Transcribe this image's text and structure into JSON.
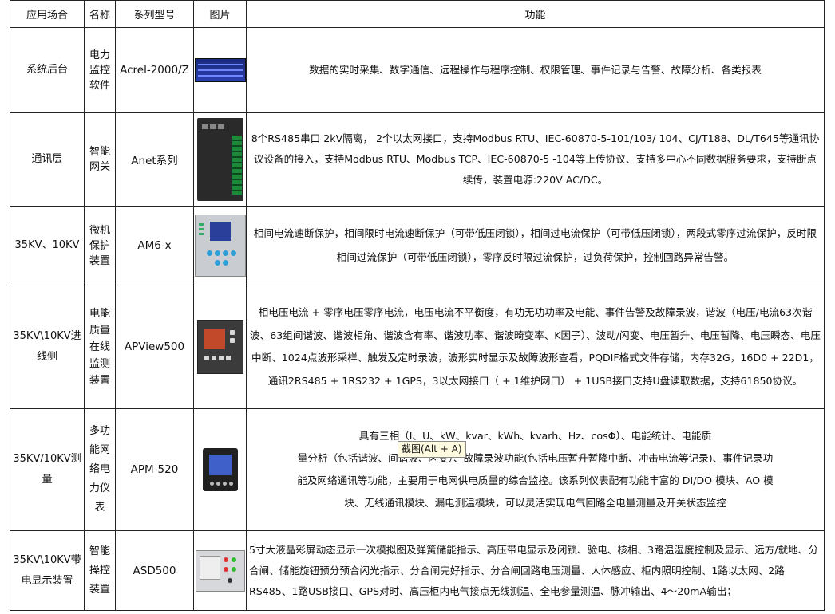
{
  "table": {
    "headers": [
      "应用场合",
      "名称",
      "系列型号",
      "图片",
      "功能"
    ],
    "rows": [
      {
        "scene": [
          "系统后台"
        ],
        "name": [
          "电力",
          "监控",
          "软件"
        ],
        "model": "Acrel-2000/Z",
        "image": "software-screenshot",
        "func": "数据的实时采集、数字通信、远程操作与程序控制、权限管理、事件记录与告警、故障分析、各类报表"
      },
      {
        "scene": [
          "通讯层"
        ],
        "name": [
          "智能",
          "网关"
        ],
        "model": "Anet系列",
        "image": "gateway-device",
        "func": "8个RS485串口 2kV隔离， 2个以太网接口，支持Modbus RTU、IEC-60870-5-101/103/ 104、CJ/T188、DL/T645等通讯协议设备的接入，支持Modbus RTU、Modbus TCP、IEC-60870-5 -104等上传协议、支持多中心不同数据服务要求，支持断点续传，装置电源:220V AC/DC。"
      },
      {
        "scene": [
          "35KV、10KV"
        ],
        "name": [
          "微机",
          "保护",
          "装置"
        ],
        "model": "AM6-x",
        "image": "protection-relay",
        "func": "相间电流速断保护，相间限时电流速断保护（可带低压闭锁），相间过电流保护（可带低压闭锁），两段式零序过流保护，反时限相间过流保护（可带低压闭锁），零序反时限过流保护，过负荷保护，控制回路异常告警。"
      },
      {
        "scene": [
          "35KV\\10KV进",
          "线侧"
        ],
        "name": [
          "电能",
          "质量",
          "在线",
          "监测",
          "装置"
        ],
        "model": "APView500",
        "image": "power-quality-monitor",
        "func": "相电压电流 + 零序电压零序电流，电压电流不平衡度，有功无功功率及电能、事件告警及故障录波，谐波（电压/电流63次谐波、63组间谐波、谐波相角、谐波含有率、谐波功率、谐波畸变率、K因子）、波动/闪变、电压暂升、电压暂降、电压瞬态、电压中断、1024点波形采样、触发及定时录波，波形实时显示及故障波形查看，PQDIF格式文件存储，内存32G，16D0 + 22D1，通讯2RS485 + 1RS232 + 1GPS，3以太网接口（ + 1维护网口） + 1USB接口支持U盘读取数据，支持61850协议。"
      },
      {
        "scene": [
          "35KV/10KV测",
          "量"
        ],
        "name": [
          "多功",
          "能网",
          "络电",
          "力仪",
          "表"
        ],
        "model": "APM-520",
        "image": "multifunction-meter",
        "func_lines": [
          "具有三相（I、U、kW、kvar、kWh、kvarh、Hz、cosΦ）、电能统计、电能质",
          "量分析（包括谐波、间谐波、闪变）、故障录波功能(包括电压暂升暂降中断、冲击电流等记录)、事件记录功",
          "能及网络通讯等功能，主要用于电网供电质量的综合监控。该系列仪表配有功能丰富的 DI/DO 模块、AO 模",
          "块、无线通讯模块、漏电测温模块，可以灵活实现电气回路全电量测量及开关状态监控"
        ]
      },
      {
        "scene": [
          "35KV\\10KV带",
          "电显示装置"
        ],
        "name": [
          "智能",
          "操控",
          "装置"
        ],
        "model": "ASD500",
        "image": "smart-control-device",
        "func": "5寸大液晶彩屏动态显示一次模拟图及弹簧储能指示、高压带电显示及闭锁、验电、核相、3路温湿度控制及显示、远方/就地、分合闸、储能旋钮预分预合闪光指示、分合闸完好指示、分合闸回路电压测量、人体感应、柜内照明控制、1路以太网、2路RS485、1路USB接口、GPS对时、高压柜内电气接点无线测温、全电参量测温、脉冲输出、4～20mA输出；"
      }
    ]
  },
  "tooltip": "截图(Alt + A)"
}
